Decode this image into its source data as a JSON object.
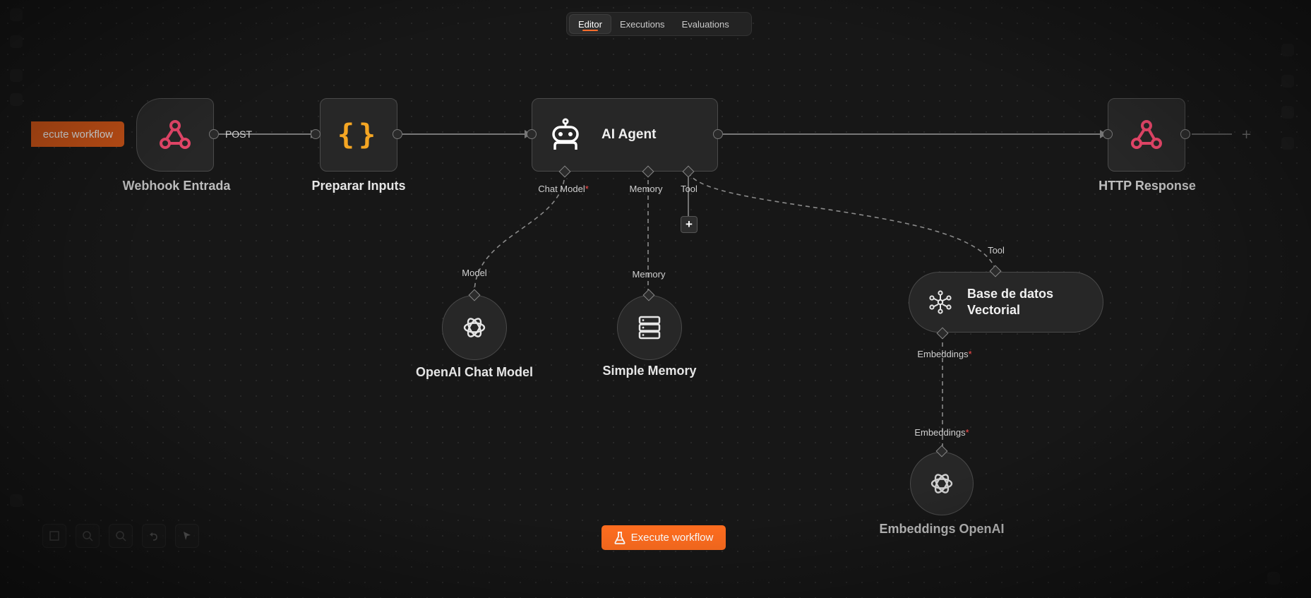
{
  "tabs": [
    {
      "label": "Editor",
      "active": true
    },
    {
      "label": "Executions",
      "active": false
    },
    {
      "label": "Evaluations",
      "active": false
    }
  ],
  "colors": {
    "accent": "#ff6d1f",
    "webhook_icon": "#e8476a",
    "code_icon": "#f5a623",
    "required": "#ff4d4d"
  },
  "nodes": {
    "webhook": {
      "label": "Webhook Entrada",
      "icon": "webhook-icon"
    },
    "prepare": {
      "label": "Preparar Inputs",
      "icon": "curly-braces-icon"
    },
    "agent": {
      "label": "AI Agent",
      "icon": "robot-icon"
    },
    "response": {
      "label": "HTTP Response",
      "icon": "webhook-icon"
    },
    "chat_model": {
      "label": "OpenAI Chat Model",
      "icon": "openai-icon"
    },
    "memory": {
      "label": "Simple Memory",
      "icon": "database-icon"
    },
    "vector": {
      "label_line1": "Base de datos",
      "label_line2": "Vectorial",
      "icon": "vector-store-icon"
    },
    "embeddings": {
      "label": "Embeddings OpenAI",
      "icon": "openai-icon"
    }
  },
  "edges": {
    "post_label": "POST"
  },
  "ports": {
    "agent_chat_model": "Chat Model",
    "agent_memory": "Memory",
    "agent_tool": "Tool",
    "chat_model_in": "Model",
    "memory_in": "Memory",
    "vector_tool_in": "Tool",
    "vector_embeddings_out": "Embeddings",
    "embeddings_in": "Embeddings",
    "required_mark": "*"
  },
  "buttons": {
    "execute_workflow": "Execute workflow",
    "execute_workflow_left": "ecute workflow",
    "add_tool": "+"
  }
}
